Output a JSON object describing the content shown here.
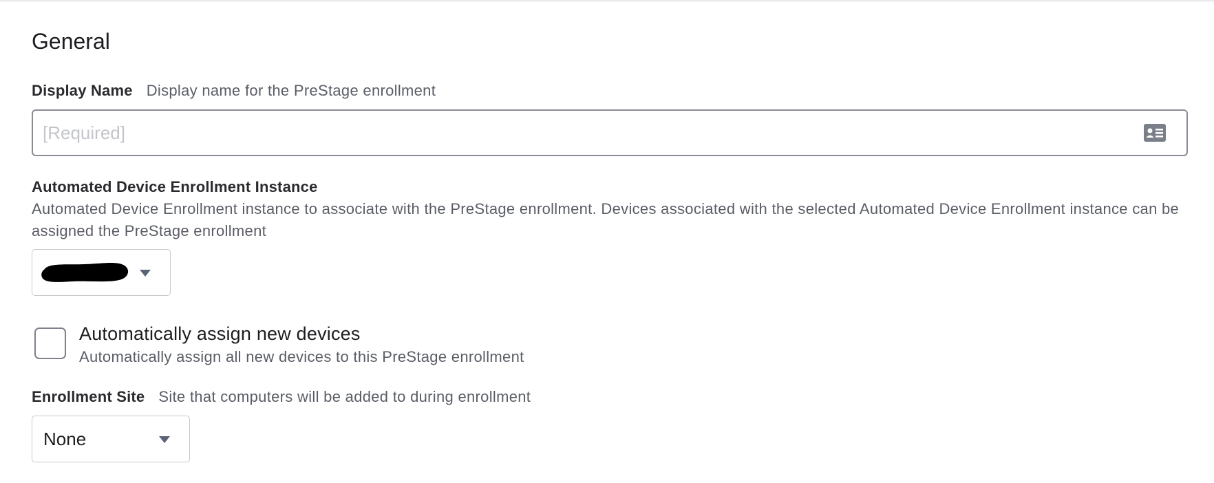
{
  "general": {
    "title": "General"
  },
  "display_name": {
    "label": "Display Name",
    "help": "Display name for the PreStage enrollment",
    "value": "",
    "placeholder": "[Required]",
    "icon": "contact-card-icon"
  },
  "ade_instance": {
    "label": "Automated Device Enrollment Instance",
    "description": "Automated Device Enrollment instance to associate with the PreStage enrollment. Devices associated with the selected Automated Device Enrollment instance can be assigned the PreStage enrollment",
    "selected_value_redacted": true,
    "icon": "chevron-down-icon"
  },
  "auto_assign": {
    "label": "Automatically assign new devices",
    "description": "Automatically assign all new devices to this PreStage enrollment",
    "checked": false
  },
  "enrollment_site": {
    "label": "Enrollment Site",
    "help": "Site that computers will be added to during enrollment",
    "selected": "None",
    "icon": "chevron-down-icon"
  },
  "colors": {
    "caret": "#5b6378",
    "help_text": "#5a5d66",
    "input_border": "#8a8d95",
    "placeholder": "#c3c5cb"
  }
}
